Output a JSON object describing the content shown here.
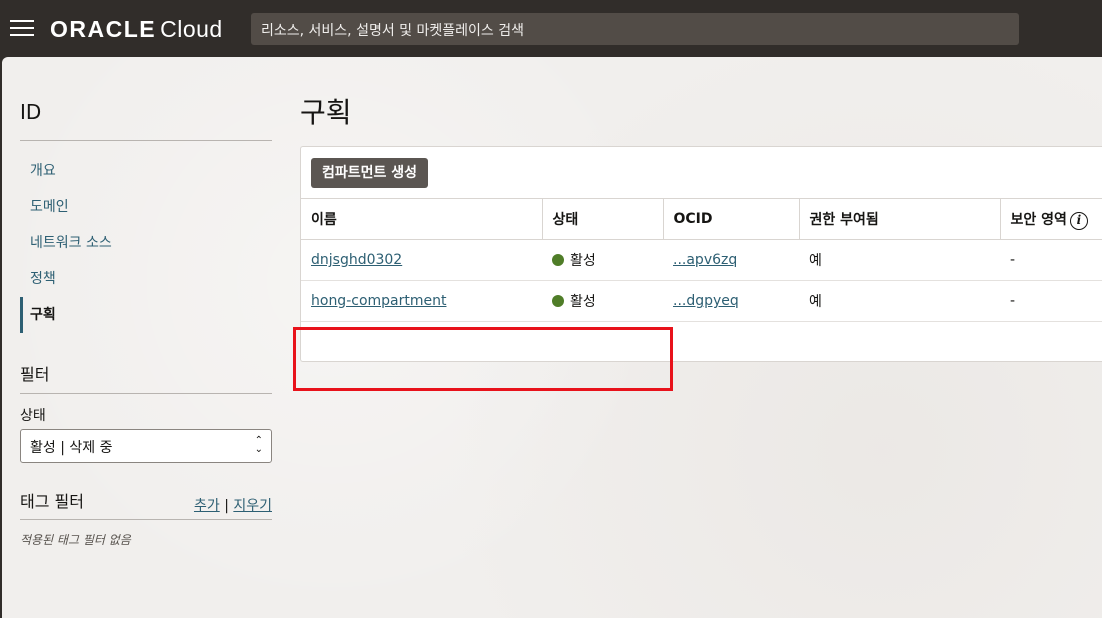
{
  "header": {
    "brand": "ORACLE",
    "product": "Cloud",
    "search_placeholder": "리소스, 서비스, 설명서 및 마켓플레이스 검색"
  },
  "sidebar": {
    "title": "ID",
    "items": [
      {
        "label": "개요"
      },
      {
        "label": "도메인"
      },
      {
        "label": "네트워크 소스"
      },
      {
        "label": "정책"
      },
      {
        "label": "구획"
      }
    ],
    "filter_title": "필터",
    "state_label": "상태",
    "state_value": "활성 | 삭제 중",
    "tag_filter_title": "태그 필터",
    "tag_add": "추가",
    "tag_sep": "|",
    "tag_clear": "지우기",
    "tag_empty": "적용된 태그 필터 없음"
  },
  "main": {
    "title": "구획",
    "create_button": "컴파트먼트 생성",
    "columns": [
      "이름",
      "상태",
      "OCID",
      "권한 부여됨",
      "보안 영역"
    ],
    "rows": [
      {
        "name": "dnjsghd0302",
        "status": "활성",
        "ocid": "...apv6zq",
        "authorized": "예",
        "security_zone": "-"
      },
      {
        "name": "hong-compartment",
        "status": "활성",
        "ocid": "...dgpyeq",
        "authorized": "예",
        "security_zone": "-"
      }
    ],
    "status_color": "#4f7d28",
    "highlight_color": "#e8121b"
  }
}
